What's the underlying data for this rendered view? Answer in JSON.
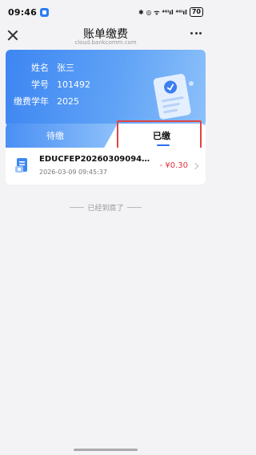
{
  "status_bar": {
    "time": "09:46",
    "right_text": "✱ ◎ ᯤ ⁴⁶ᴵıl ⁴⁶ᴵıl",
    "battery": "70"
  },
  "nav": {
    "title": "账单缴费",
    "subtitle": "cloud.bankcomm.com"
  },
  "hero": {
    "rows": [
      {
        "label": "姓名",
        "value": "张三"
      },
      {
        "label": "学号",
        "value": "101492"
      },
      {
        "label": "缴费学年",
        "value": "2025"
      }
    ]
  },
  "tabs": {
    "pending": "待缴",
    "paid": "已缴"
  },
  "bills": [
    {
      "id": "EDUCFEP202603090945...",
      "time": "2026-03-09 09:45:37",
      "amount": "- ¥0.30"
    }
  ],
  "end_text": "已经到底了",
  "colors": {
    "accent": "#2b6ef0",
    "amount": "#e0333f",
    "highlight": "#e04444"
  }
}
